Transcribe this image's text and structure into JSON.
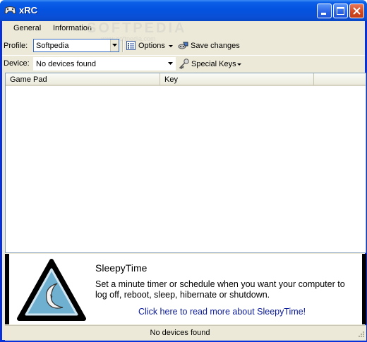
{
  "window": {
    "title": "xRC",
    "icon": "gamepad-icon",
    "title_buttons": [
      "minimize-icon",
      "maximize-icon",
      "close-icon"
    ],
    "title_color": "#0453e0"
  },
  "menu": {
    "items": [
      {
        "label": "General"
      },
      {
        "label": "Information"
      }
    ]
  },
  "watermark": {
    "text": "SOFTPEDIA",
    "sub": "www.softpedia.com"
  },
  "toolbar": {
    "profile_label": "Profile:",
    "profile_value": "Softpedia",
    "options_label": "Options",
    "options_icon": "options-icon",
    "save_label": "Save changes",
    "save_icon": "save-changes-icon",
    "device_label": "Device:",
    "device_value": "No devices found",
    "special_keys_label": "Special Keys",
    "special_keys_icon": "key-icon"
  },
  "table": {
    "columns": [
      "Game Pad",
      "Key",
      ""
    ],
    "rows": []
  },
  "ad": {
    "title": "SleepyTime",
    "description": "Set a minute timer or schedule when you want your computer to log off, reboot, sleep, hibernate or shutdown.",
    "link_text": "Click here to read more about SleepyTime!",
    "logo_icon": "moon-icon",
    "link_color": "#0a1a9a"
  },
  "status": {
    "text": "No devices found"
  }
}
